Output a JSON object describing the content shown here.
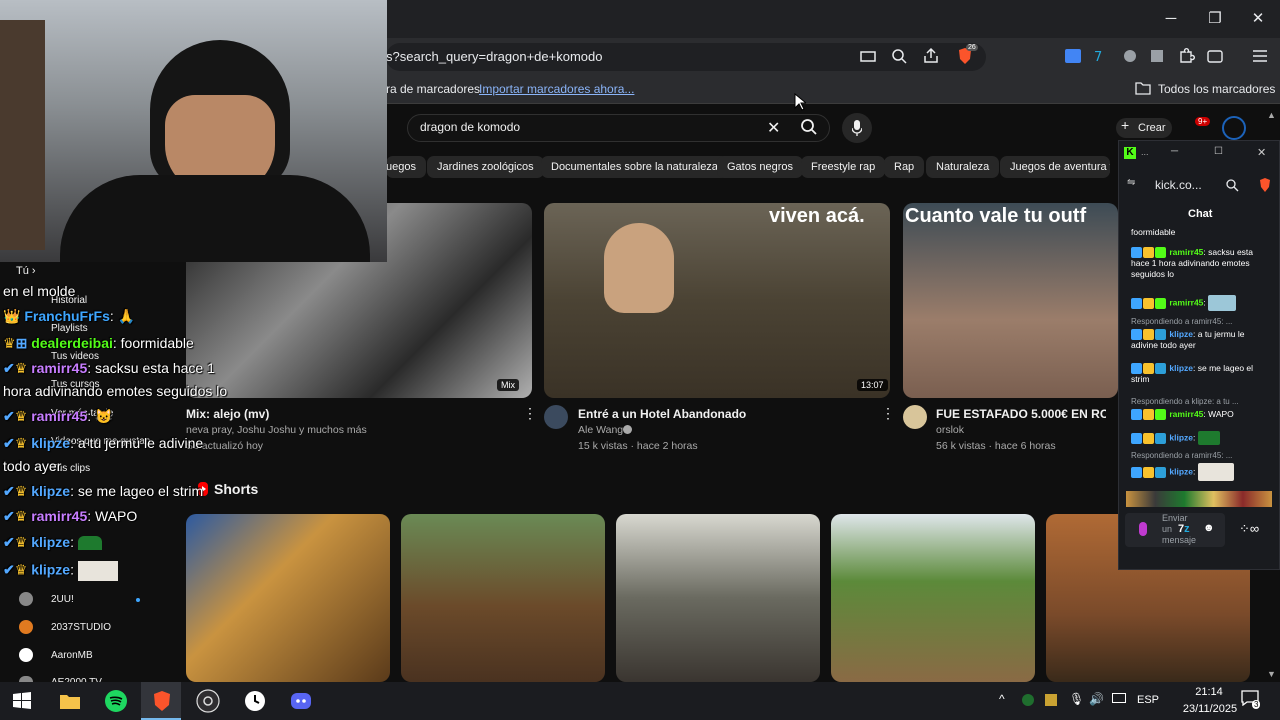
{
  "browser": {
    "url": "s?search_query=dragon+de+komodo",
    "brave_badge": "26",
    "bookmarks_bar_text": "ra de marcadores",
    "import_link": "Importar marcadores ahora...",
    "all_bookmarks": "Todos los marcadores"
  },
  "youtube": {
    "search_value": "dragon de komodo",
    "create_label": "Crear",
    "notif_count": "9+",
    "chips": [
      "uegos",
      "Jardines zoológicos",
      "Documentales sobre la naturaleza",
      "Gatos negros",
      "Freestyle rap",
      "Rap",
      "Naturaleza",
      "Juegos de aventura y"
    ],
    "videos": [
      {
        "title": "Mix: alejo (mv)",
        "channel": "neva pray, Joshu Joshu y muchos más",
        "meta": "Se actualizó hoy",
        "badge": "Mix"
      },
      {
        "title": "Entré a un Hotel Abandonado",
        "channel": "Ale Wang",
        "meta": "15 k vistas · hace 2 horas",
        "badge": "13:07",
        "overlay": "viven acá."
      },
      {
        "title": "FUE ESTAFADO 5.000€ EN ROPA R",
        "channel": "orslok",
        "meta": "56 k vistas · hace 6 horas",
        "overlay": "Cuanto vale tu outf"
      }
    ],
    "shorts_label": "Shorts"
  },
  "sidebar": {
    "you": "Tú",
    "items": [
      "Historial",
      "Playlists",
      "Tus videos",
      "Tus cursos",
      "Ver más tarde",
      "Videos que me gustan",
      "Tus clips"
    ],
    "subscriptions": [
      "2UU!",
      "2037STUDIO",
      "AaronMB",
      "AE2000 TV"
    ]
  },
  "overlay_chat": [
    {
      "user": "",
      "text": "en el molde"
    },
    {
      "user": "FranchuFrFs",
      "text": ""
    },
    {
      "user": "dealerdeibai",
      "text": "foormidable"
    },
    {
      "user": "ramirr45",
      "text": "sacksu esta hace 1"
    },
    {
      "user": "",
      "text": "hora adivinando emotes seguidos lo"
    },
    {
      "user": "ramirr45",
      "text": ""
    },
    {
      "user": "klipze",
      "text": "a tu jermu le adivine"
    },
    {
      "user": "",
      "text": "todo ayer"
    },
    {
      "user": "klipze",
      "text": "se me lageo el strim"
    },
    {
      "user": "ramirr45",
      "text": "WAPO"
    },
    {
      "user": "klipze",
      "text": ""
    },
    {
      "user": "klipze",
      "text": ""
    }
  ],
  "kick": {
    "title": "kick.co...",
    "chat_label": "Chat",
    "messages": [
      {
        "reply": "",
        "user": "",
        "text": "foormidable"
      },
      {
        "reply": "",
        "user": "ramirr45",
        "text": "sacksu esta hace 1 hora adivinando emotes seguidos lo"
      },
      {
        "reply": "",
        "user": "ramirr45",
        "text": ""
      },
      {
        "reply": "Respondiendo a ramirr45: ...",
        "user": "klipze",
        "text": "a tu jermu le adivine todo ayer"
      },
      {
        "reply": "",
        "user": "klipze",
        "text": "se me lageo el strim"
      },
      {
        "reply": "Respondiendo a klipze: a tu ...",
        "user": "ramirr45",
        "text": "WAPO"
      },
      {
        "reply": "",
        "user": "klipze",
        "text": ""
      },
      {
        "reply": "Respondiendo a ramirr45: ...",
        "user": "klipze",
        "text": ""
      }
    ],
    "input_placeholder": "Enviar un mensaje",
    "count": "7"
  },
  "taskbar": {
    "language": "ESP",
    "time": "21:14",
    "date": "23/11/2025",
    "notifications": "3"
  },
  "colors": {
    "kick_green": "#53fc18",
    "yt_red": "#ff0000",
    "brave_orange": "#fb542b"
  }
}
